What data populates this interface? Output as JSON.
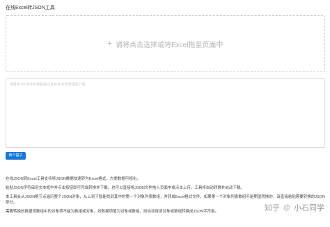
{
  "header": {
    "title": "在线Excel转JSON工具"
  },
  "dropzone": {
    "icon": "plus-icon",
    "label": "请将点击选择或将Excel拖至页面中"
  },
  "editor": {
    "placeholder": "或者将JSON字符串粘贴在此处并点击按钮后下载",
    "value": ""
  },
  "toolbar": {
    "convert_label": "转个垂子"
  },
  "description": {
    "lines": [
      "在线JSON转Excel工具支持将JSON数据快速转为Excel格式，方便数据可视化。",
      "粘贴JSON字符串到文本框中并点击按钮即可完成转换并下载，也可以直接将JSON文件拖入页面中或点击上传，工具将自动转换并启动下载。",
      "本工具会从JSON根节点遍历整个JSON对象，从上到下智能找到其中的第一个对象列表数组，并转成Excel格式文件，如果第一个对象列表数组不是期望转换的，请直接粘贴需要转换的JSON部分。",
      "需要转换的数据须数组中的对象项不能为数组或对象，如数据项值为对象或数组，则自动将该对象或数组转换成JSON字符串。"
    ]
  },
  "watermark": {
    "brand": "知乎",
    "author": "小石同学"
  }
}
